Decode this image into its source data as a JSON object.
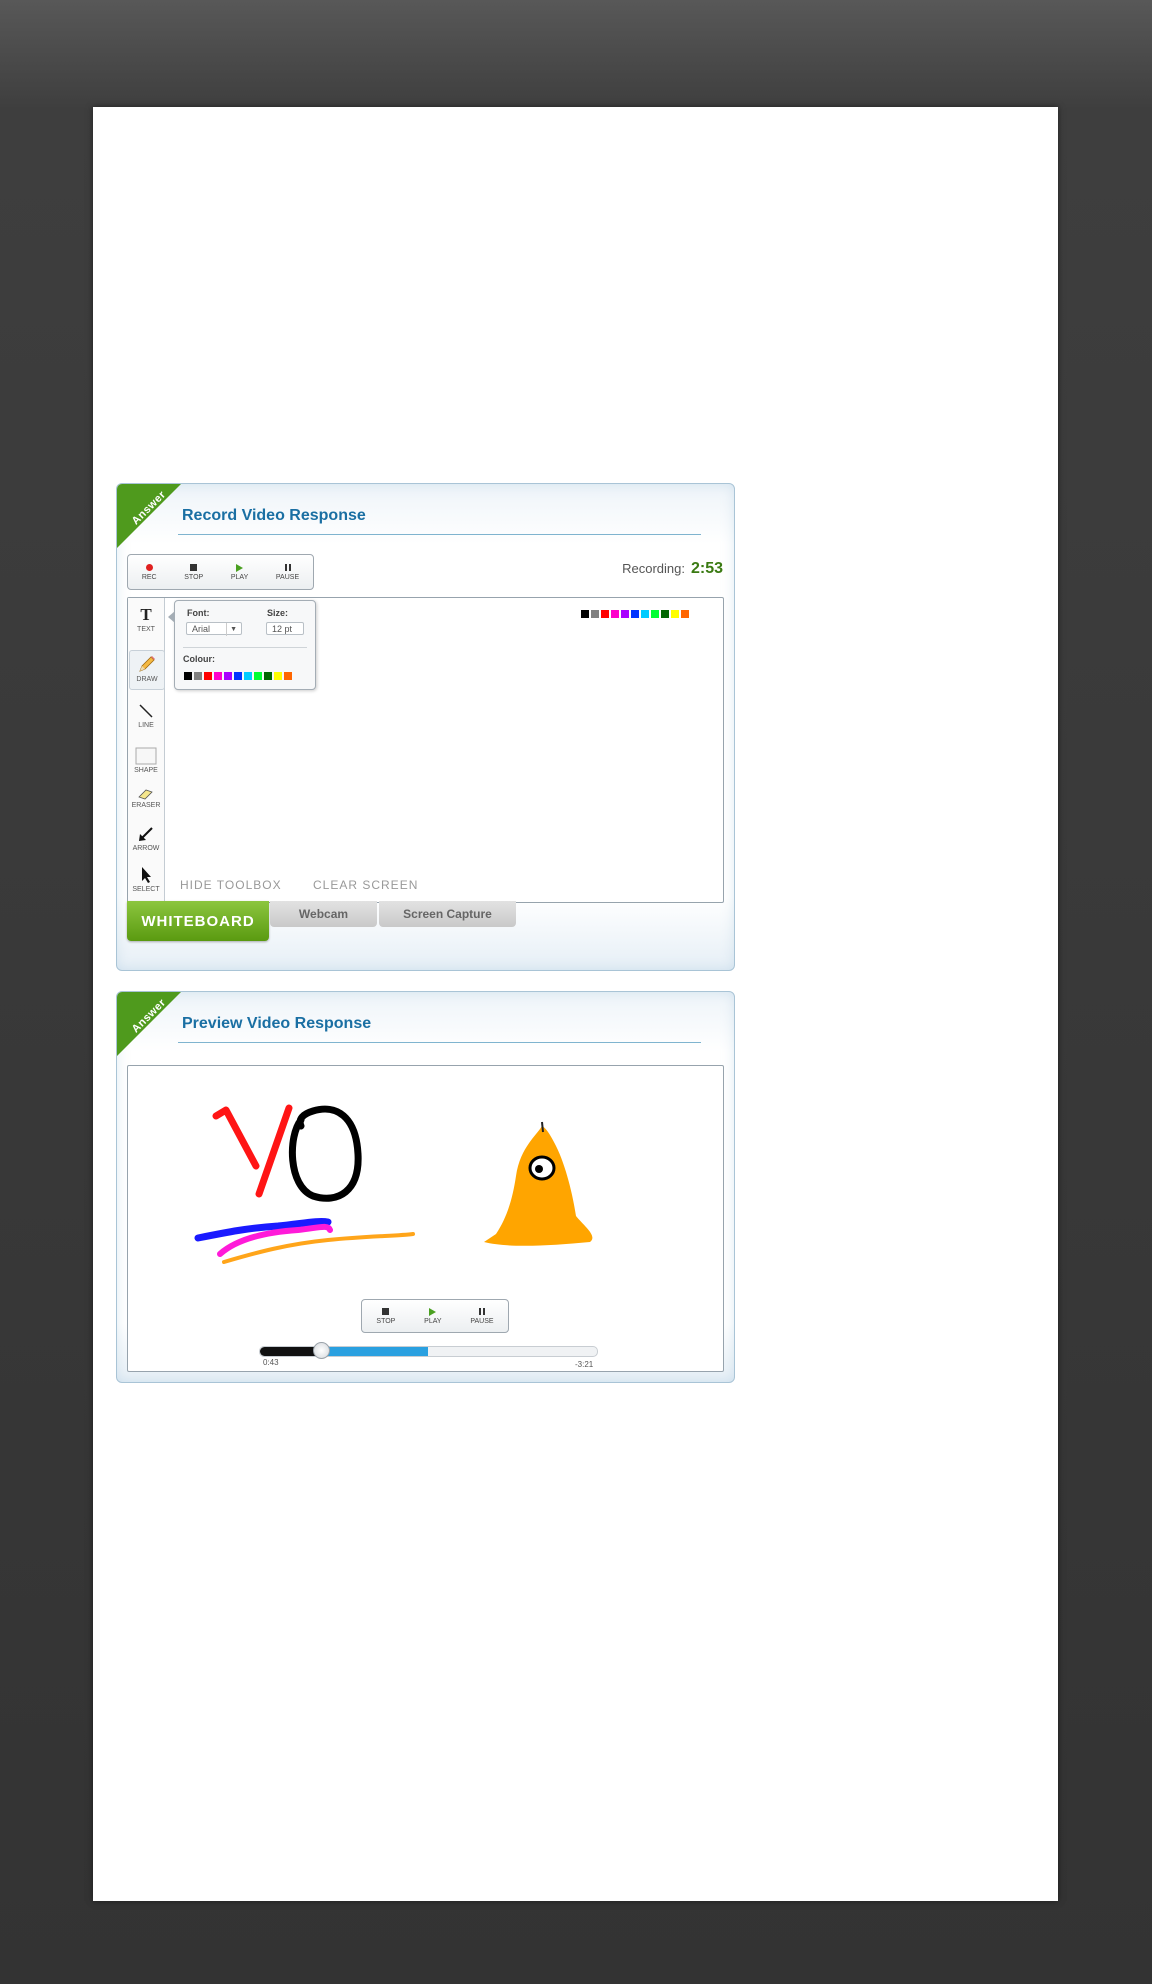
{
  "record_panel": {
    "ribbon": "Answer",
    "title": "Record Video Response",
    "controls": {
      "rec": "REC",
      "stop": "STOP",
      "play": "PLAY",
      "pause": "PAUSE"
    },
    "recording_label": "Recording:",
    "recording_time": "2:53",
    "tools": [
      {
        "label": "TEXT",
        "icon": "text-tool-icon"
      },
      {
        "label": "DRAW",
        "icon": "pencil-icon"
      },
      {
        "label": "LINE",
        "icon": "line-tool-icon"
      },
      {
        "label": "SHAPE",
        "icon": "shape-tool-icon"
      },
      {
        "label": "ERASER",
        "icon": "eraser-icon"
      },
      {
        "label": "ARROW",
        "icon": "arrow-tool-icon"
      },
      {
        "label": "SELECT",
        "icon": "cursor-icon"
      }
    ],
    "text_popup": {
      "font_label": "Font:",
      "font_value": "Arial",
      "size_label": "Size:",
      "size_value": "12 pt",
      "colour_label": "Colour:"
    },
    "palette_colors": [
      "#000000",
      "#808080",
      "#ff0000",
      "#ff00cc",
      "#aa00ff",
      "#0033ff",
      "#00ccff",
      "#00ff33",
      "#006600",
      "#ffff00",
      "#ff6600"
    ],
    "popup_palette_colors": [
      "#000000",
      "#808080",
      "#ff0000",
      "#ff00cc",
      "#aa00ff",
      "#0033ff",
      "#00ccff",
      "#00ff33",
      "#006600",
      "#ffff00",
      "#ff6600"
    ],
    "hide_toolbox": "HIDE TOOLBOX",
    "clear_screen": "CLEAR SCREEN",
    "tabs": {
      "whiteboard": "WHITEBOARD",
      "webcam": "Webcam",
      "screen_capture": "Screen Capture"
    }
  },
  "preview_panel": {
    "ribbon": "Answer",
    "title": "Preview Video Response",
    "controls": {
      "stop": "STOP",
      "play": "PLAY",
      "pause": "PAUSE"
    },
    "elapsed": "0:43",
    "remaining": "-3:21",
    "progress_played_fraction": 0.18,
    "progress_buffered_fraction": 0.5
  },
  "colors": {
    "accent_green": "#5a9a10",
    "title_blue": "#1a6fa3",
    "seek_blue": "#2aa0e0",
    "drawing_orange": "#ffaa00"
  }
}
